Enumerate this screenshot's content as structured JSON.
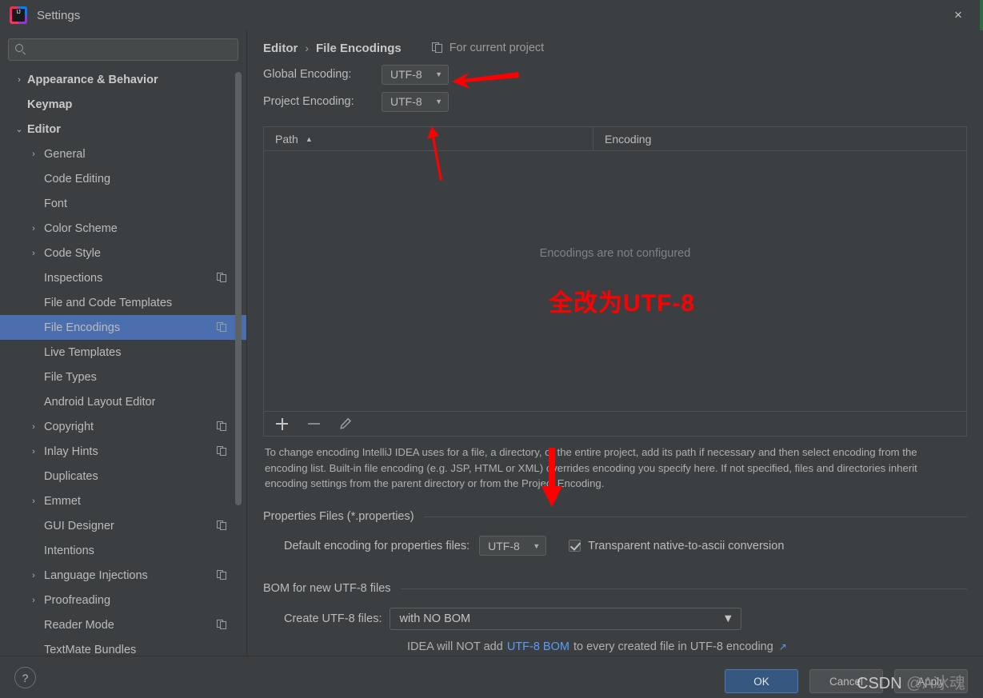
{
  "window": {
    "title": "Settings",
    "logo_text": "IJ",
    "close_icon": "×"
  },
  "sidebar": {
    "search": {
      "value": "",
      "placeholder": ""
    },
    "items": [
      {
        "label": "Appearance & Behavior",
        "depth": 1,
        "arrow": "›",
        "bold": true,
        "selected": false,
        "copy": false
      },
      {
        "label": "Keymap",
        "depth": 1,
        "arrow": "",
        "bold": true,
        "selected": false,
        "copy": false
      },
      {
        "label": "Editor",
        "depth": 1,
        "arrow": "⌄",
        "bold": true,
        "selected": false,
        "copy": false
      },
      {
        "label": "General",
        "depth": 2,
        "arrow": "›",
        "bold": false,
        "selected": false,
        "copy": false
      },
      {
        "label": "Code Editing",
        "depth": 2,
        "arrow": "",
        "bold": false,
        "selected": false,
        "copy": false
      },
      {
        "label": "Font",
        "depth": 2,
        "arrow": "",
        "bold": false,
        "selected": false,
        "copy": false
      },
      {
        "label": "Color Scheme",
        "depth": 2,
        "arrow": "›",
        "bold": false,
        "selected": false,
        "copy": false
      },
      {
        "label": "Code Style",
        "depth": 2,
        "arrow": "›",
        "bold": false,
        "selected": false,
        "copy": false
      },
      {
        "label": "Inspections",
        "depth": 2,
        "arrow": "",
        "bold": false,
        "selected": false,
        "copy": true
      },
      {
        "label": "File and Code Templates",
        "depth": 2,
        "arrow": "",
        "bold": false,
        "selected": false,
        "copy": false
      },
      {
        "label": "File Encodings",
        "depth": 2,
        "arrow": "",
        "bold": false,
        "selected": true,
        "copy": true
      },
      {
        "label": "Live Templates",
        "depth": 2,
        "arrow": "",
        "bold": false,
        "selected": false,
        "copy": false
      },
      {
        "label": "File Types",
        "depth": 2,
        "arrow": "",
        "bold": false,
        "selected": false,
        "copy": false
      },
      {
        "label": "Android Layout Editor",
        "depth": 2,
        "arrow": "",
        "bold": false,
        "selected": false,
        "copy": false
      },
      {
        "label": "Copyright",
        "depth": 2,
        "arrow": "›",
        "bold": false,
        "selected": false,
        "copy": true
      },
      {
        "label": "Inlay Hints",
        "depth": 2,
        "arrow": "›",
        "bold": false,
        "selected": false,
        "copy": true
      },
      {
        "label": "Duplicates",
        "depth": 2,
        "arrow": "",
        "bold": false,
        "selected": false,
        "copy": false
      },
      {
        "label": "Emmet",
        "depth": 2,
        "arrow": "›",
        "bold": false,
        "selected": false,
        "copy": false
      },
      {
        "label": "GUI Designer",
        "depth": 2,
        "arrow": "",
        "bold": false,
        "selected": false,
        "copy": true
      },
      {
        "label": "Intentions",
        "depth": 2,
        "arrow": "",
        "bold": false,
        "selected": false,
        "copy": false
      },
      {
        "label": "Language Injections",
        "depth": 2,
        "arrow": "›",
        "bold": false,
        "selected": false,
        "copy": true
      },
      {
        "label": "Proofreading",
        "depth": 2,
        "arrow": "›",
        "bold": false,
        "selected": false,
        "copy": false
      },
      {
        "label": "Reader Mode",
        "depth": 2,
        "arrow": "",
        "bold": false,
        "selected": false,
        "copy": true
      },
      {
        "label": "TextMate Bundles",
        "depth": 2,
        "arrow": "",
        "bold": false,
        "selected": false,
        "copy": false
      }
    ]
  },
  "main": {
    "breadcrumb": {
      "parent": "Editor",
      "separator": "›",
      "current": "File Encodings"
    },
    "for_current_project": "For current project",
    "global_encoding": {
      "label": "Global Encoding:",
      "value": "UTF-8"
    },
    "project_encoding": {
      "label": "Project Encoding:",
      "value": "UTF-8"
    },
    "table": {
      "columns": [
        "Path",
        "Encoding"
      ],
      "sort_indicator": "▲",
      "rows": [],
      "empty_message": "Encodings are not configured",
      "toolbar": {
        "add": "+",
        "remove": "−",
        "edit": "pencil"
      }
    },
    "help_text": "To change encoding IntelliJ IDEA uses for a file, a directory, or the entire project, add its path if necessary and then select encoding from the encoding list. Built-in file encoding (e.g. JSP, HTML or XML) overrides encoding you specify here. If not specified, files and directories inherit encoding settings from the parent directory or from the Project Encoding.",
    "properties_group": {
      "title": "Properties Files (*.properties)",
      "default_encoding_label": "Default encoding for properties files:",
      "default_encoding_value": "UTF-8",
      "transparent_label": "Transparent native-to-ascii conversion",
      "transparent_checked": true
    },
    "bom_group": {
      "title": "BOM for new UTF-8 files",
      "create_label": "Create UTF-8 files:",
      "create_value": "with NO BOM",
      "note_prefix": "IDEA will NOT add",
      "note_link": "UTF-8 BOM",
      "note_suffix": "to every created file in UTF-8 encoding",
      "external_icon": "↗"
    }
  },
  "bottom": {
    "help": "?",
    "ok": "OK",
    "cancel": "Cancel",
    "apply": "Apply"
  },
  "annotations": {
    "red_note": "全改为UTF-8",
    "watermark_brand": "CSDN",
    "watermark_user": "@A冰魂",
    "accent_red": "#ff0000",
    "accent_blue": "#4b6eaf",
    "link_blue": "#589df6"
  }
}
